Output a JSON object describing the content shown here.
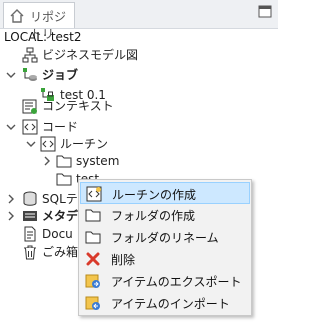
{
  "tab": {
    "title": "リポジトリ",
    "icon": "home-icon"
  },
  "local_label": "LOCAL: test2",
  "tree": {
    "business_model": "ビジネスモデル図",
    "job": "ジョブ",
    "job_item": "test 0.1",
    "context": "コンテキスト",
    "code": "コード",
    "routine": "ルーチン",
    "system": "system",
    "test": "test",
    "sql": "SQLテ",
    "metadata": "メタデ",
    "docs": "Docu",
    "trash": "ごみ箱"
  },
  "context_menu": {
    "items": [
      {
        "label": "ルーチンの作成",
        "icon": "routine-create-icon"
      },
      {
        "label": "フォルダの作成",
        "icon": "folder-create-icon"
      },
      {
        "label": "フォルダのリネーム",
        "icon": "folder-rename-icon"
      },
      {
        "label": "削除",
        "icon": "delete-icon"
      },
      {
        "label": "アイテムのエクスポート",
        "icon": "export-icon"
      },
      {
        "label": "アイテムのインポート",
        "icon": "import-icon"
      }
    ]
  },
  "colors": {
    "selection": "#cde8ff",
    "accent_green": "#3aa33a",
    "delete_red": "#d93a2b",
    "folder": "#f3c54d"
  }
}
